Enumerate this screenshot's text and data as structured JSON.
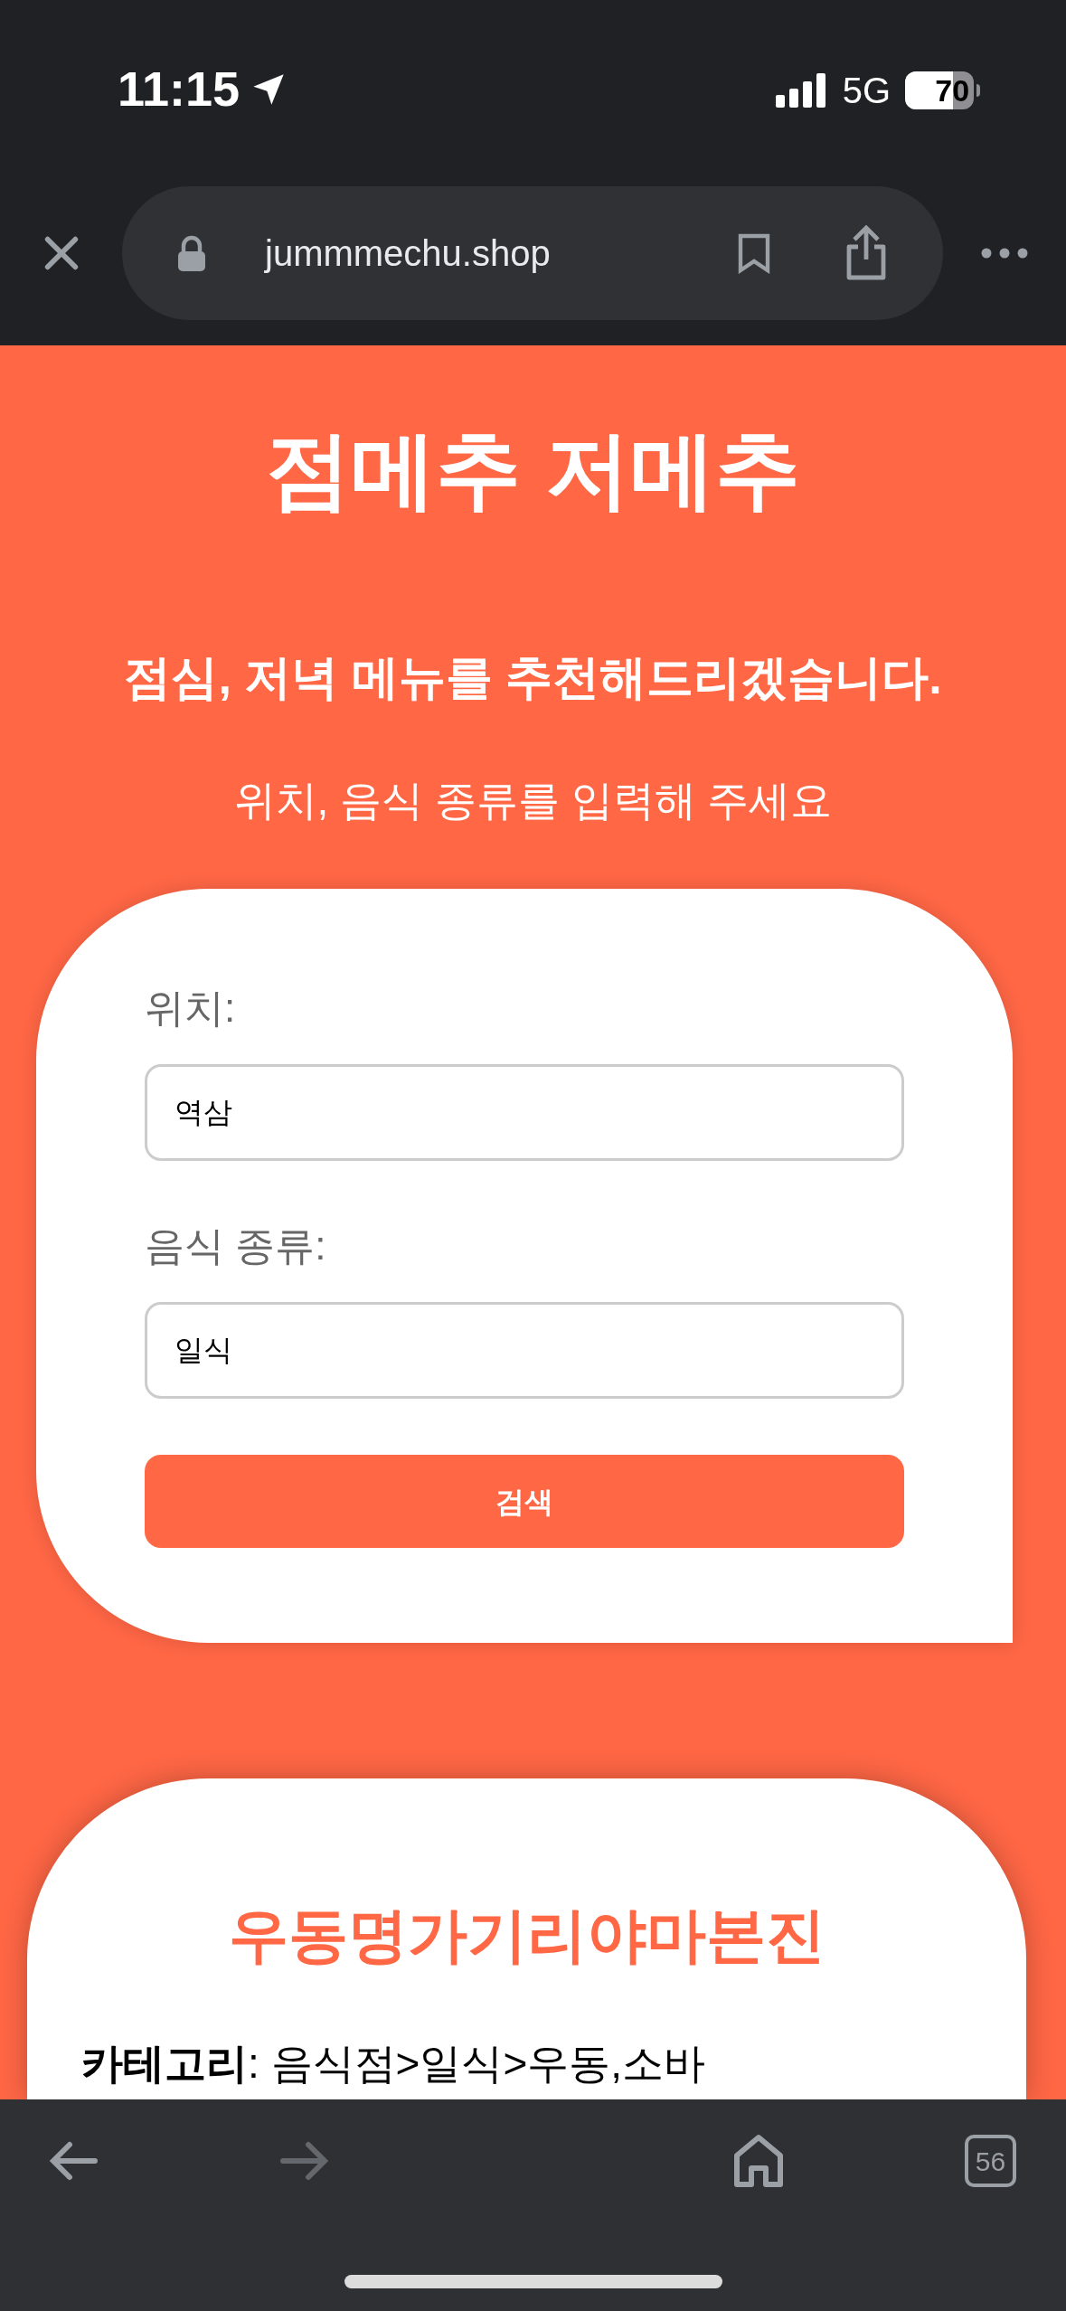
{
  "status_bar": {
    "time": "11:15",
    "network": "5G",
    "battery": "70"
  },
  "browser": {
    "url": "jummmechu.shop",
    "tab_count": "56"
  },
  "page": {
    "title": "점메추 저메추",
    "subtitle": "점심, 저녁 메뉴를 추천해드리겠습니다.",
    "instruction": "위치, 음식 종류를 입력해 주세요",
    "form": {
      "fields": [
        {
          "label": "위치:",
          "value": "역삼"
        },
        {
          "label": "음식 종류:",
          "value": "일식"
        }
      ],
      "button": "검색"
    },
    "result": {
      "name": "우동명가기리야마본진",
      "category": "**카테고리**: 음식점>일식>우동,소바"
    }
  }
}
